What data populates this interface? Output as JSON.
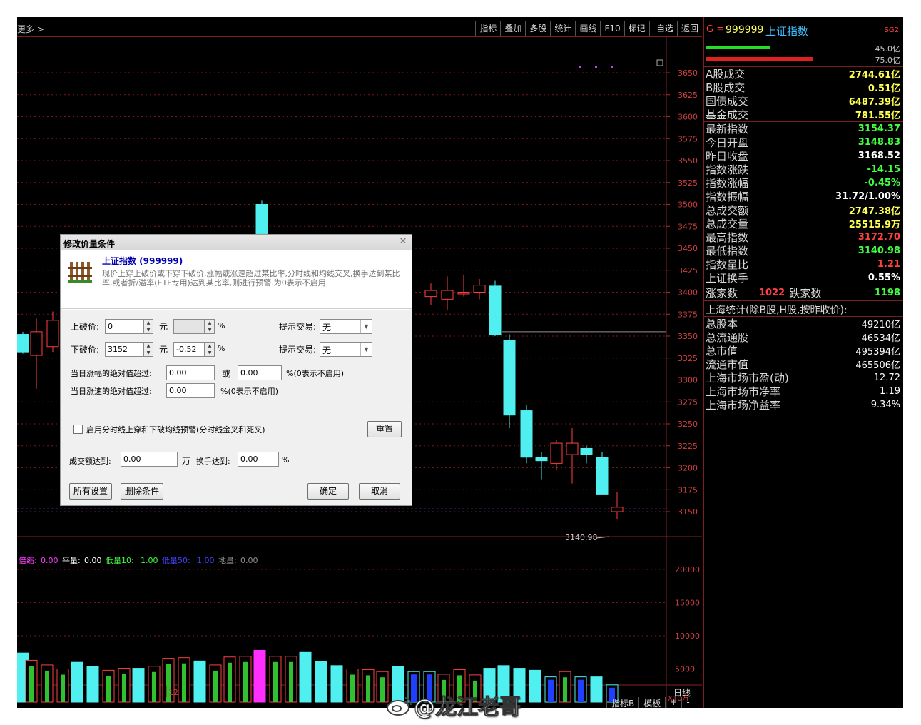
{
  "topbar": {
    "more": "更多 >",
    "buttons": [
      "指标",
      "叠加",
      "多股",
      "统计",
      "画线",
      "F10",
      "标记",
      "-自选",
      "返回"
    ]
  },
  "chart": {
    "price_axis": [
      "3650",
      "3625",
      "3600",
      "3575",
      "3550",
      "3525",
      "3500",
      "3475",
      "3450",
      "3425",
      "3400",
      "3375",
      "3350",
      "3325",
      "3300",
      "3275",
      "3250",
      "3225",
      "3200",
      "3175",
      "3150"
    ],
    "low_marker": "3140.98",
    "volume_axis": [
      "20000",
      "15000",
      "10000",
      "5000"
    ],
    "volume_unit": "X10万",
    "month_label": "12",
    "indicator_line": {
      "items": [
        {
          "label": "倍缩:",
          "value": "0.00",
          "color": "#ff40ff"
        },
        {
          "label": "平量:",
          "value": "0.00",
          "color": "#ffffff"
        },
        {
          "label": "低量10:",
          "value": "1.00",
          "color": "#40ff40"
        },
        {
          "label": "低量50:",
          "value": "1.00",
          "color": "#4040ff"
        },
        {
          "label": "地量:",
          "value": "0.00",
          "color": "#909090"
        }
      ]
    }
  },
  "bottom": {
    "period": "日线",
    "tabs": [
      "指标B",
      "模板",
      "+",
      "-"
    ]
  },
  "panel": {
    "g": "G ≡",
    "code": "999999",
    "name": "上证指数",
    "sg": "SG2",
    "flow_top": "45.0亿",
    "flow_bottom": "75.0亿",
    "turnover_rows": [
      {
        "k": "A股成交",
        "v": "2744.61亿",
        "c": "yellow"
      },
      {
        "k": "B股成交",
        "v": "0.51亿",
        "c": "yellow"
      },
      {
        "k": "国债成交",
        "v": "6487.39亿",
        "c": "yellow"
      },
      {
        "k": "基金成交",
        "v": "781.55亿",
        "c": "yellow"
      }
    ],
    "index_rows": [
      {
        "k": "最新指数",
        "v": "3154.37",
        "c": "green"
      },
      {
        "k": "今日开盘",
        "v": "3148.83",
        "c": "green"
      },
      {
        "k": "昨日收盘",
        "v": "3168.52",
        "c": "white"
      },
      {
        "k": "指数涨跌",
        "v": "-14.15",
        "c": "green"
      },
      {
        "k": "指数涨幅",
        "v": "-0.45%",
        "c": "green"
      },
      {
        "k": "指数振幅",
        "v": "31.72/1.00%",
        "c": "white"
      },
      {
        "k": "总成交额",
        "v": "2747.38亿",
        "c": "yellow"
      },
      {
        "k": "总成交量",
        "v": "25515.9万",
        "c": "yellow"
      },
      {
        "k": "最高指数",
        "v": "3172.70",
        "c": "red"
      },
      {
        "k": "最低指数",
        "v": "3140.98",
        "c": "green"
      },
      {
        "k": "指数量比",
        "v": "1.21",
        "c": "red"
      },
      {
        "k": "上证换手",
        "v": "0.55%",
        "c": "white"
      }
    ],
    "up_label": "涨家数",
    "up_value": "1022",
    "down_label": "跌家数",
    "down_value": "1198",
    "sh_title": "上海统计(除B股,H股,按昨收价):",
    "sh_rows": [
      {
        "k": "总股本",
        "v": "49210亿"
      },
      {
        "k": "总流通股",
        "v": "46534亿"
      },
      {
        "k": "总市值",
        "v": "495394亿"
      },
      {
        "k": "流通市值",
        "v": "465506亿"
      },
      {
        "k": "上海市场市盈(动)",
        "v": "12.72"
      },
      {
        "k": "上海市场市净率",
        "v": "1.19"
      },
      {
        "k": "上海市场净益率",
        "v": "9.34%"
      }
    ]
  },
  "dialog": {
    "title": "修改价量条件",
    "stock": "上证指数 (999999)",
    "description": "现价上穿上破价或下穿下破价,涨幅或涨速超过某比率,分时线和均线交叉,换手达到某比率,或者折/溢率(ETF专用)达到某比率,则进行预警.为0表示不启用",
    "upper_label": "上破价:",
    "upper_value": "0",
    "upper_pct": "",
    "lower_label": "下破价:",
    "lower_value": "3152",
    "lower_pct": "-0.52",
    "yuan": "元",
    "pct": "%",
    "hint_label": "提示交易:",
    "hint_value_1": "无",
    "hint_value_2": "无",
    "rise_label": "当日涨幅的绝对值超过:",
    "rise_value_1": "0.00",
    "or": "或",
    "rise_value_2": "0.00",
    "rise_note": "%(0表示不启用)",
    "speed_label": "当日涨速的绝对值超过:",
    "speed_value": "0.00",
    "speed_note": "%(0表示不启用)",
    "cross_label": "启用分时线上穿和下破均线预警(分时线金叉和死叉)",
    "reset": "重置",
    "amount_label": "成交额达到:",
    "amount_value": "0.00",
    "wan": "万",
    "turnover_label": "换手达到:",
    "turnover_value": "0.00",
    "btn_all": "所有设置",
    "btn_delete": "删除条件",
    "btn_ok": "确定",
    "btn_cancel": "取消"
  },
  "watermark": "@龙江老哥"
}
